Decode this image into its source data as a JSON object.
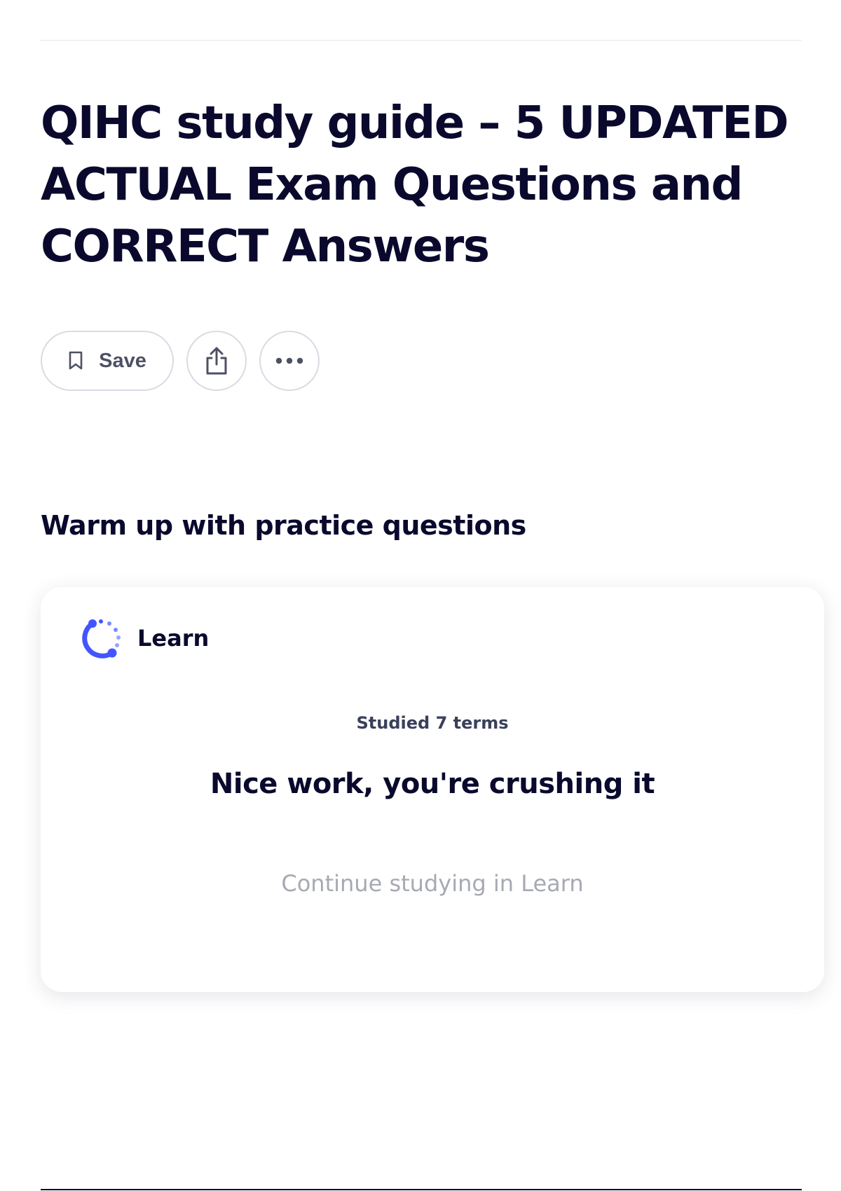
{
  "header": {
    "title": "QIHC study guide – 5 UPDATED ACTUAL Exam Questions and CORRECT Answers"
  },
  "actions": {
    "save_label": "Save",
    "save_icon": "bookmark-icon",
    "share_icon": "share-icon",
    "more_icon": "more-horizontal-icon"
  },
  "practice": {
    "heading": "Warm up with practice questions",
    "card": {
      "mode_label": "Learn",
      "mode_icon": "learn-progress-icon",
      "studied_text": "Studied 7 terms",
      "message": "Nice work, you're crushing it",
      "continue_label": "Continue studying in Learn"
    }
  },
  "colors": {
    "text_primary": "#0a092d",
    "border": "#d9dbe3",
    "accent": "#4255ff",
    "muted": "#a7aab3"
  }
}
